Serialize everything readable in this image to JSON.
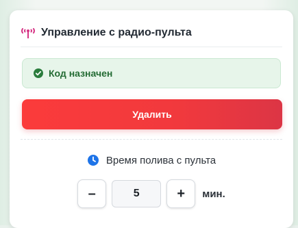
{
  "card": {
    "title": "Управление с радио-пульта",
    "title_icon": "radio-antenna-icon"
  },
  "status": {
    "icon": "check-circle-icon",
    "text": "Код назначен",
    "color": "#236b33",
    "background": "#e7f5ea"
  },
  "delete_button": {
    "label": "Удалить",
    "color": "#f1393d"
  },
  "timer": {
    "icon": "clock-icon",
    "label": "Время полива с пульта",
    "decrement_label": "–",
    "increment_label": "+",
    "value": "5",
    "unit": "мин."
  }
}
